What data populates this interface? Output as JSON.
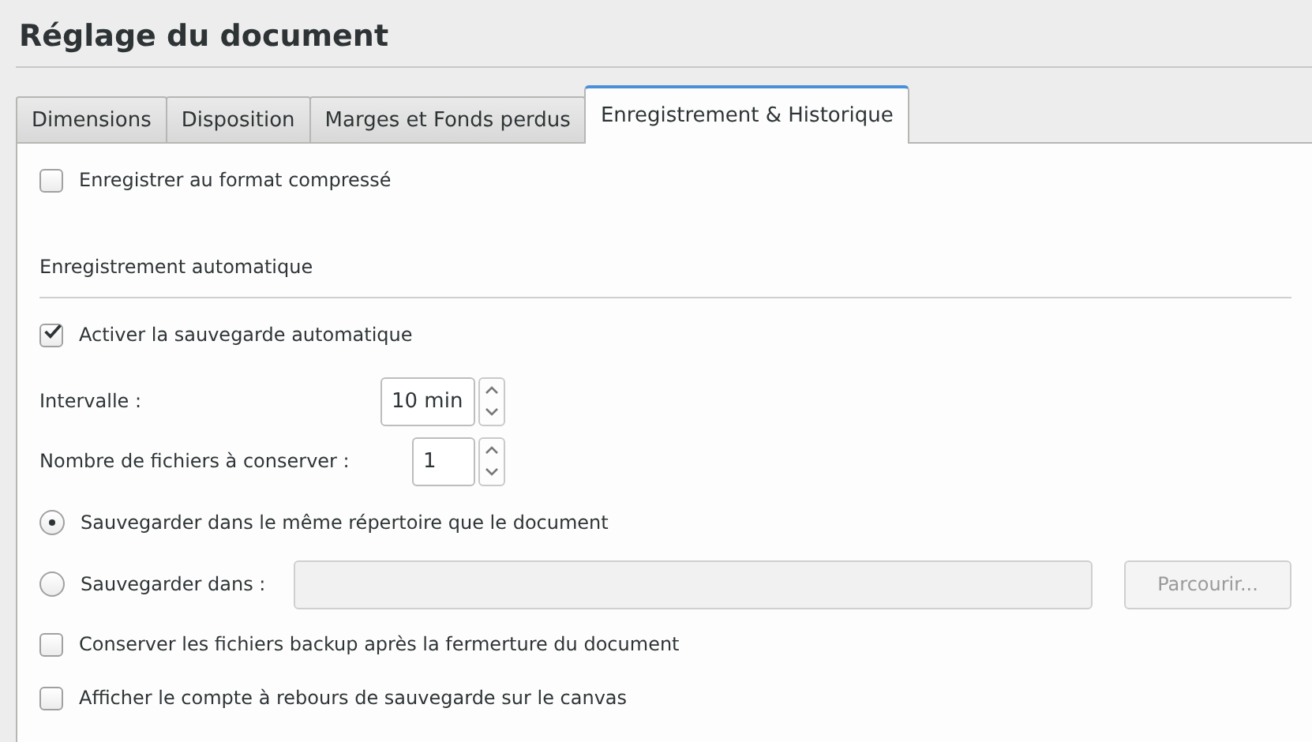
{
  "window": {
    "title": "Réglage du document"
  },
  "tabs": [
    {
      "label": "Dimensions",
      "selected": false
    },
    {
      "label": "Disposition",
      "selected": false
    },
    {
      "label": "Marges et Fonds perdus",
      "selected": false
    },
    {
      "label": "Enregistrement & Historique",
      "selected": true
    }
  ],
  "compress": {
    "label": "Enregistrer au format compressé",
    "checked": false
  },
  "autosave": {
    "heading": "Enregistrement automatique",
    "enable": {
      "label": "Activer la sauvegarde automatique",
      "checked": true
    },
    "spinners": [
      {
        "label": "Intervalle :",
        "value": "10 min"
      },
      {
        "label": "Nombre de fichiers  à conserver :",
        "value": "1"
      }
    ],
    "locations": [
      {
        "label": "Sauvegarder dans le même répertoire que le document",
        "selected": true
      },
      {
        "label": "Sauvegarder dans :",
        "selected": false
      }
    ],
    "path_field": {
      "disabled": true
    },
    "browse_button": {
      "label": "Parcourir...",
      "disabled": true
    },
    "options": [
      {
        "label": "Conserver les fichiers backup après la fermerture du document",
        "checked": false
      },
      {
        "label": "Afficher le compte à rebours de sauvegarde sur le canvas",
        "checked": false
      }
    ]
  }
}
